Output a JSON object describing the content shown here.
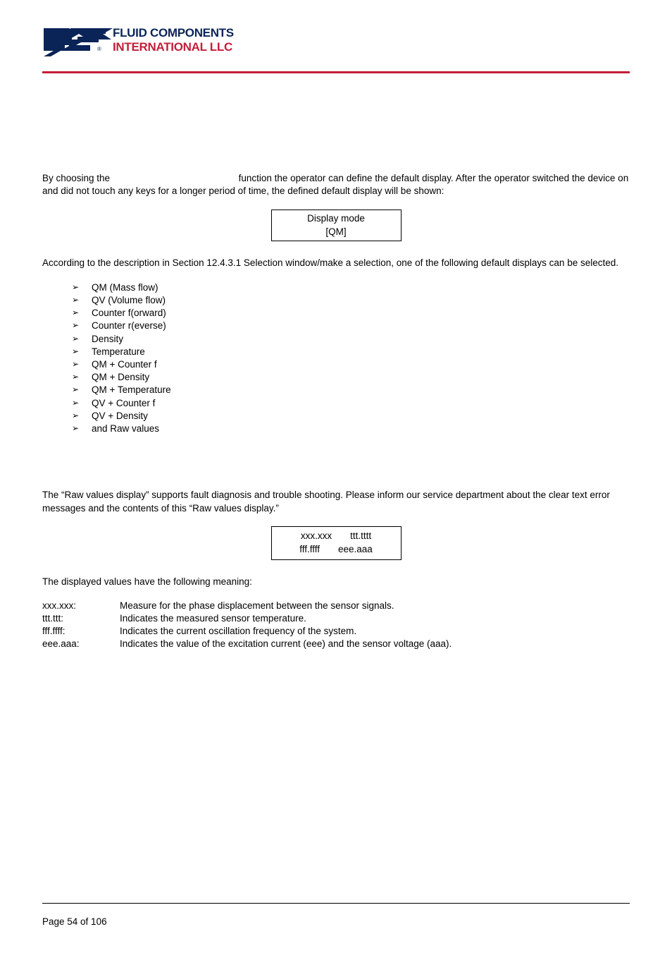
{
  "logo": {
    "line1": "FLUID COMPONENTS",
    "line2": "INTERNATIONAL LLC",
    "alt": "FCI Fluid Components International LLC"
  },
  "section1": {
    "p1_a": "By choosing the",
    "p1_b": "function the operator can define the default display. After the operator switched the device on and did not touch any keys for a longer period of time, the defined default display will be shown:"
  },
  "display_box": {
    "row1": "Display mode",
    "row2": "[QM]"
  },
  "section1_p2": "According to the description in Section 12.4.3.1 Selection window/make a selection, one of the following default displays can be selected.",
  "options": [
    "QM (Mass flow)",
    "QV (Volume flow)",
    "Counter f(orward)",
    "Counter r(everse)",
    "Density",
    "Temperature",
    "QM + Counter f",
    "QM + Density",
    "QM + Temperature",
    "QV + Counter f",
    "QV + Density",
    "and Raw values"
  ],
  "section2": {
    "p1": "The “Raw values display” supports fault diagnosis and trouble shooting. Please inform our service department about the clear text error messages and the contents of this “Raw values display.”"
  },
  "raw_box": {
    "r1c1": "xxx.xxx",
    "r1c2": "ttt.tttt",
    "r2c1": "fff.ffff",
    "r2c2": "eee.aaa"
  },
  "section3": {
    "intro": "The displayed values have the following meaning:"
  },
  "defs": [
    {
      "key": "xxx.xxx:",
      "val": "Measure for the phase displacement between the sensor signals."
    },
    {
      "key": "ttt.ttt:",
      "val": "Indicates the measured sensor temperature."
    },
    {
      "key": "fff.ffff:",
      "val": "Indicates the current oscillation frequency of the system."
    },
    {
      "key": "eee.aaa:",
      "val": "Indicates the value of the excitation current (eee) and the sensor voltage (aaa)."
    }
  ],
  "footer": {
    "page": "Page 54 of 106"
  }
}
